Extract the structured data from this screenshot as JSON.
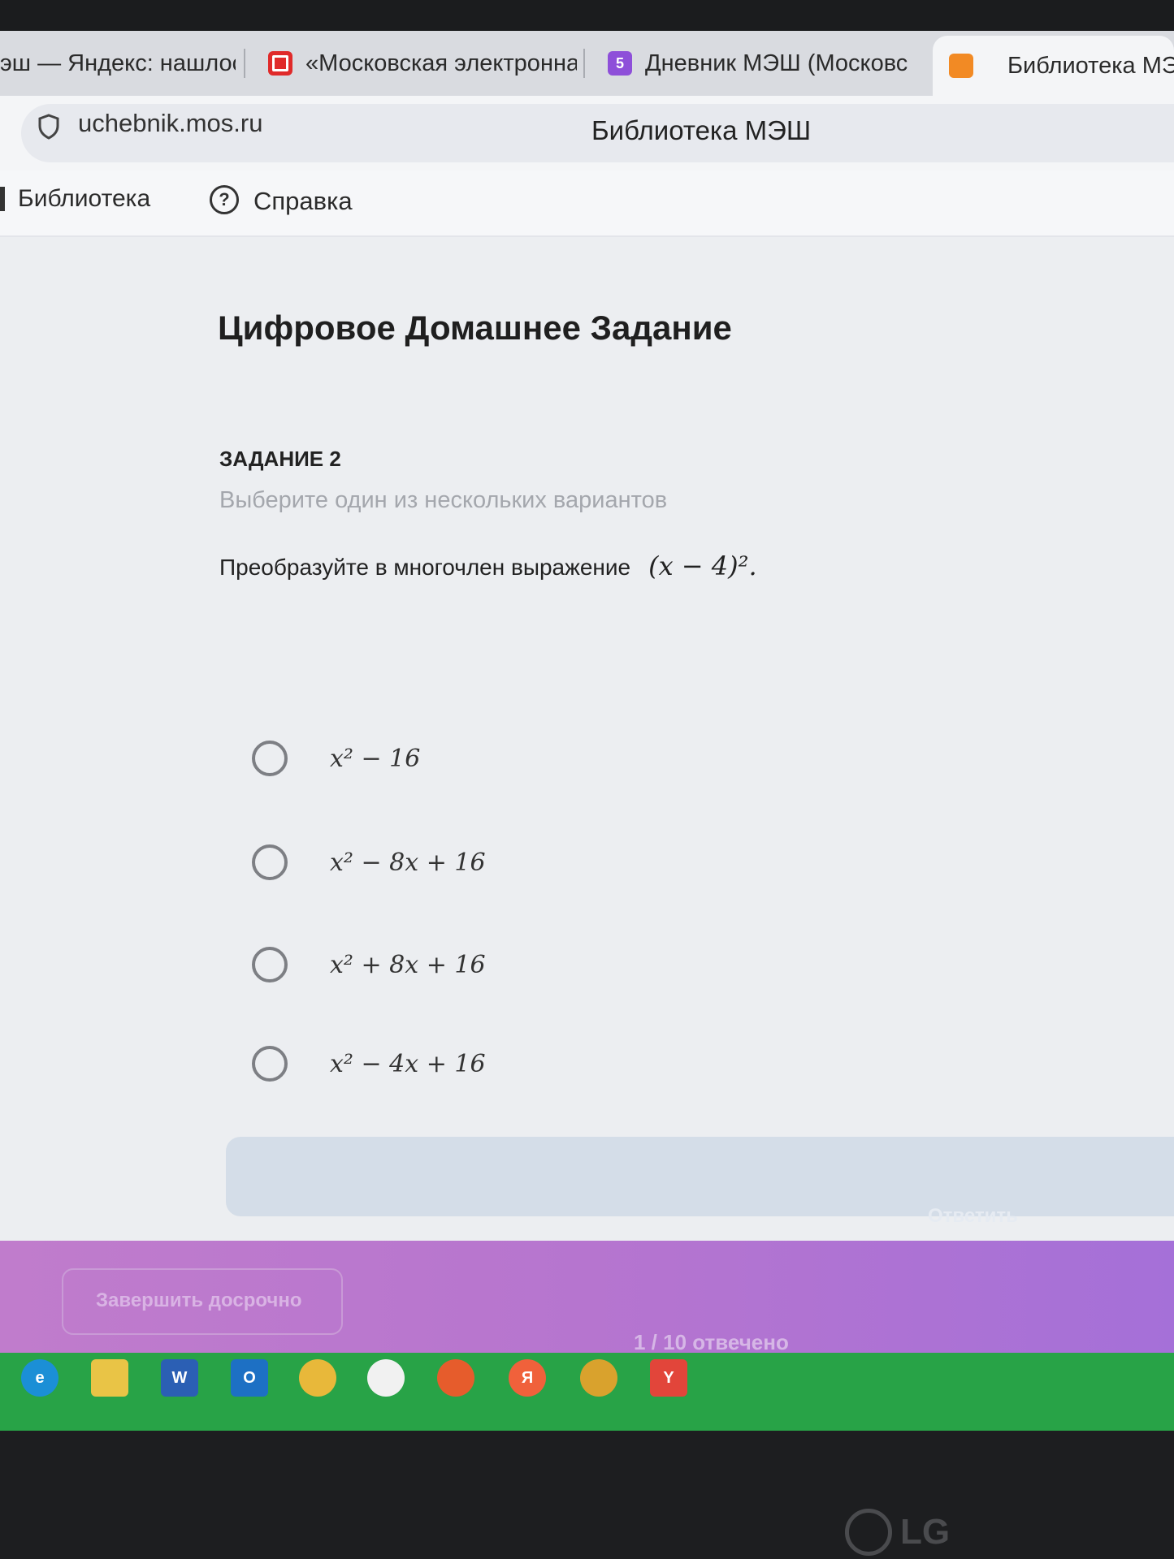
{
  "browser": {
    "tabs": [
      {
        "label": "эш — Яндекс: нашлось"
      },
      {
        "label": "«Московская электронна"
      },
      {
        "label": "Дневник МЭШ (Московс"
      },
      {
        "label": "Библиотека МЭ"
      }
    ],
    "tab_badge": "5",
    "url": "uchebnik.mos.ru",
    "page_title": "Библиотека МЭШ"
  },
  "nav": {
    "library": "Библиотека",
    "help": "Справка",
    "help_icon_glyph": "?"
  },
  "page": {
    "heading": "Цифровое Домашнее Задание",
    "task_number": "ЗАДАНИЕ 2",
    "task_hint": "Выберите один из нескольких вариантов",
    "question_text": "Преобразуйте в многочлен выражение",
    "question_expr": "(x − 4)².",
    "options": [
      {
        "text": "x² − 16"
      },
      {
        "text": "x² − 8x + 16"
      },
      {
        "text": "x² + 8x + 16"
      },
      {
        "text": "x² − 4x + 16"
      }
    ],
    "answer_button": "Ответить"
  },
  "footer": {
    "finish_button": "Завершить досрочно",
    "counter": "1 / 10 отвечено"
  },
  "taskbar": {
    "icons": [
      "edge-icon",
      "file-explorer-icon",
      "word-icon",
      "outlook-icon",
      "app-icon",
      "app-icon-2",
      "firefox-icon",
      "yandex-icon",
      "notification-app-icon",
      "yandex-browser-icon"
    ]
  },
  "monitor": {
    "brand": "LG"
  },
  "colors": {
    "footer_purple": "#b675cf",
    "answer_button": "#d4dde8",
    "taskbar_green": "#28a347"
  }
}
